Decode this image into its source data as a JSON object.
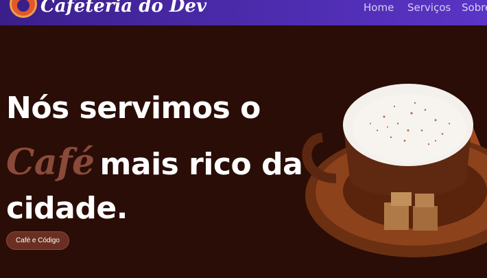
{
  "header": {
    "brand": "Cafeteria do Dev",
    "nav": [
      "Home",
      "Serviços",
      "Sobre"
    ]
  },
  "hero": {
    "line1": "Nós servimos o",
    "accent_word": "Café",
    "line2_rest": "mais rico da",
    "line3": "cidade.",
    "cta_label": "Café e Código"
  },
  "colors": {
    "background": "#2a0d06",
    "header_start": "#3a1f8a",
    "header_end": "#5a34c6",
    "accent": "#8a4a3a",
    "button": "#6a2f22"
  },
  "icons": {
    "logo": "coffee-logo-icon",
    "photo": "coffee-cup-image"
  }
}
